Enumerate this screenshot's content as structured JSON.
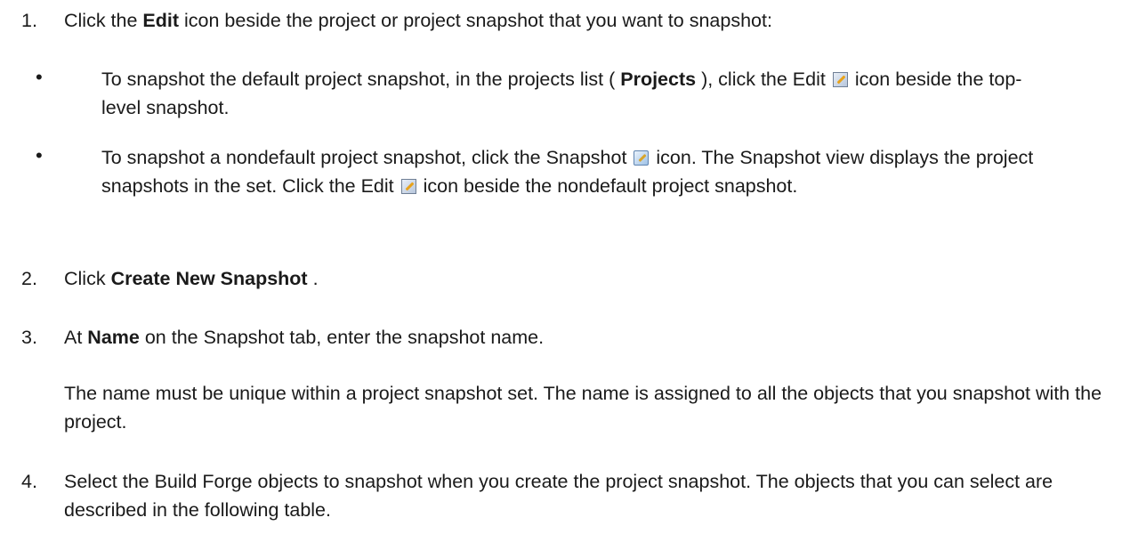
{
  "steps": [
    {
      "num": "1.",
      "pre": "Click the ",
      "bold": "Edit",
      "post": " icon beside the project or project snapshot that you want to snapshot:"
    },
    {
      "num": "2.",
      "pre": "Click ",
      "bold": "Create New Snapshot",
      "post": " ."
    },
    {
      "num": "3.",
      "pre": "At ",
      "bold": "Name",
      "post": " on the Snapshot tab, enter the snapshot name.",
      "note": "The name must be unique within a project snapshot set. The name is assigned to all the objects that you snapshot with the project."
    },
    {
      "num": "4.",
      "text": "Select the Build Forge objects to snapshot when you create the project snapshot. The objects that you can select are described in the following table."
    }
  ],
  "bullets": [
    {
      "symbol": "•",
      "pre": "To snapshot the default project snapshot, in the projects list ( ",
      "bold": "Projects",
      "mid": " ), click the Edit ",
      "icon": "edit-icon",
      "post": " icon beside the top-level snapshot."
    },
    {
      "symbol": "•",
      "pre": "To snapshot a nondefault project snapshot, click the Snapshot ",
      "icon": "snapshot-icon",
      "mid": " icon. The Snapshot view displays the project snapshots in the set. Click the Edit ",
      "icon2": "edit-icon",
      "post": " icon beside the nondefault project snapshot."
    }
  ]
}
